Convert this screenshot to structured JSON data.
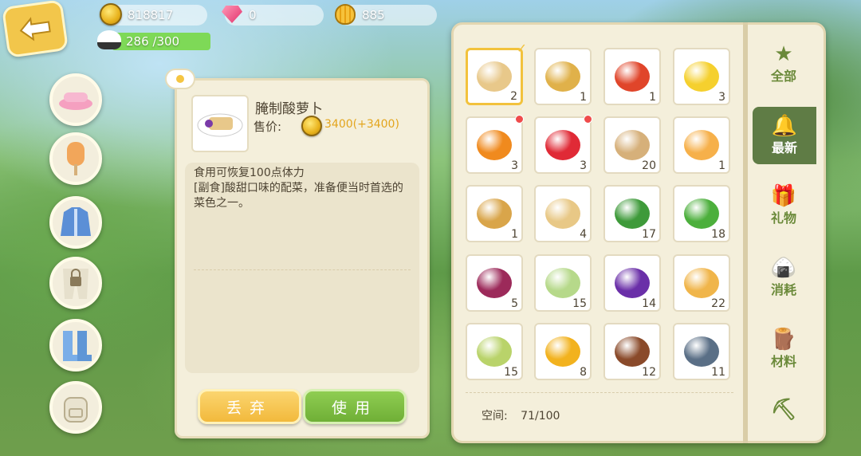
{
  "resources": {
    "coins": "818817",
    "gems": "0",
    "shells": "885",
    "stamina": "286 /300"
  },
  "item": {
    "name": "腌制酸萝卜",
    "price_label": "售价:",
    "price_value": "3400(+3400)",
    "description": "食用可恢复100点体力\n[副食]酸甜口味的配菜，准备便当时首选的菜色之一。"
  },
  "buttons": {
    "discard": "丢弃",
    "use": "使用"
  },
  "inventory": {
    "space_label": "空间:",
    "space_value": "71/100",
    "items": [
      {
        "name": "pickled-radish",
        "count": "2",
        "color": "#e8c88a",
        "selected": true
      },
      {
        "name": "dish",
        "count": "1",
        "color": "#e0b14a"
      },
      {
        "name": "tomato-dish",
        "count": "1",
        "color": "#e0452a"
      },
      {
        "name": "banana",
        "count": "3",
        "color": "#f5d02e"
      },
      {
        "name": "pumpkin",
        "count": "3",
        "color": "#f08a1e",
        "new": true
      },
      {
        "name": "strawberry",
        "count": "3",
        "color": "#e02a36",
        "new": true
      },
      {
        "name": "flour-sack",
        "count": "20",
        "color": "#d6b07a"
      },
      {
        "name": "mango-slice",
        "count": "1",
        "color": "#f6b04a"
      },
      {
        "name": "wheat",
        "count": "1",
        "color": "#d9a54a"
      },
      {
        "name": "seed-bag",
        "count": "4",
        "color": "#e8c886"
      },
      {
        "name": "watermelon",
        "count": "17",
        "color": "#3e9a3a"
      },
      {
        "name": "broccoli",
        "count": "18",
        "color": "#4caf3c"
      },
      {
        "name": "onion",
        "count": "5",
        "color": "#9c2a5a"
      },
      {
        "name": "cabbage",
        "count": "15",
        "color": "#b6d98a"
      },
      {
        "name": "eggplant",
        "count": "14",
        "color": "#6a2fa8"
      },
      {
        "name": "potato",
        "count": "22",
        "color": "#f0b54a"
      },
      {
        "name": "artichoke",
        "count": "15",
        "color": "#b9d36a"
      },
      {
        "name": "pineapple",
        "count": "8",
        "color": "#f2b21e"
      },
      {
        "name": "cocoa",
        "count": "12",
        "color": "#8a4a2a"
      },
      {
        "name": "fish",
        "count": "11",
        "color": "#5a6f86"
      }
    ]
  },
  "tabs": [
    {
      "label": "全部",
      "icon": "star-icon",
      "glyph": "★"
    },
    {
      "label": "最新",
      "icon": "bell-icon",
      "glyph": "🔔",
      "active": true
    },
    {
      "label": "礼物",
      "icon": "gift-icon",
      "glyph": "🎁"
    },
    {
      "label": "消耗",
      "icon": "rice-ball-icon",
      "glyph": "🍙"
    },
    {
      "label": "材料",
      "icon": "wood-icon",
      "glyph": "🪵"
    },
    {
      "label": "",
      "icon": "shovel-icon",
      "glyph": "⛏"
    }
  ],
  "nav": [
    {
      "icon": "visor-hat-icon"
    },
    {
      "icon": "popsicle-icon"
    },
    {
      "icon": "jacket-icon"
    },
    {
      "icon": "locked-pants-icon"
    },
    {
      "icon": "boots-icon"
    },
    {
      "icon": "backpack-icon"
    }
  ],
  "colors": {
    "panel": "#f4efdb",
    "gold": "#e3a51d",
    "green": "#6faf36",
    "tab_active": "#5f7c45"
  }
}
